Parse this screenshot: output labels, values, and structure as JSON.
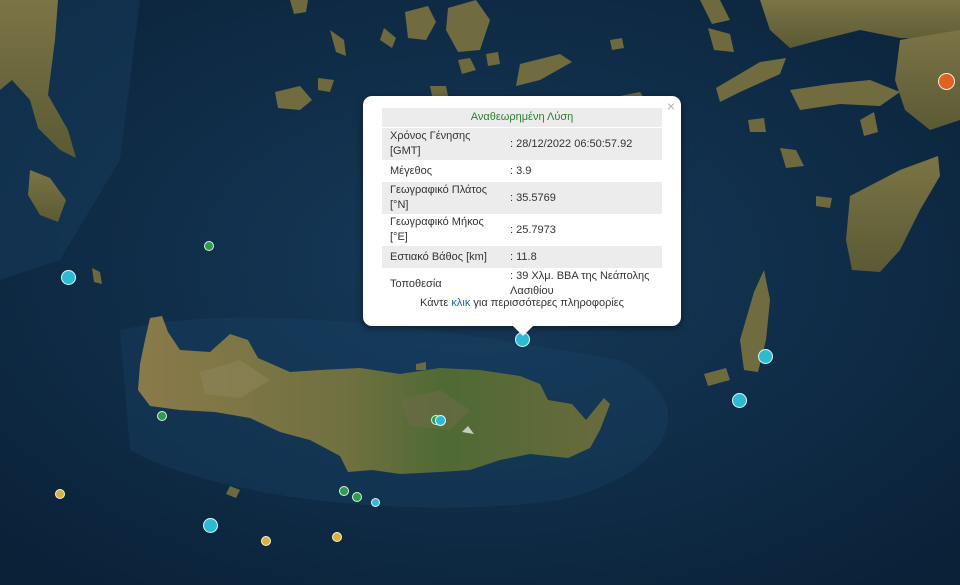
{
  "popup": {
    "title": "Αναθεωρημένη Λύση",
    "close_label": "×",
    "rows": [
      {
        "label": "Χρόνος Γένησης [GMT]",
        "value": ": 28/12/2022 06:50:57.92"
      },
      {
        "label": "Μέγεθος",
        "value": ": 3.9"
      },
      {
        "label": "Γεωγραφικό Πλάτος [°N]",
        "value": ": 35.5769"
      },
      {
        "label": "Γεωγραφικό Μήκος [°E]",
        "value": ": 25.7973"
      },
      {
        "label": "Εστιακό Βάθος [km]",
        "value": ": 11.8"
      },
      {
        "label": "Τοποθεσία",
        "value": ": 39 Χλμ. ΒΒΑ της Νεάπολης Λασιθίου"
      }
    ],
    "footer_prefix": "Κάντε ",
    "footer_link": "κλικ",
    "footer_suffix": " για περισσότερες πληροφορίες"
  },
  "map_colors": {
    "sea": "#0d2a44",
    "land": "#6e6a3e",
    "quake_cyan": "#2bbcd4",
    "quake_green": "#2e9d4a",
    "quake_yellow": "#d8b23a",
    "quake_orange": "#e0621e"
  }
}
